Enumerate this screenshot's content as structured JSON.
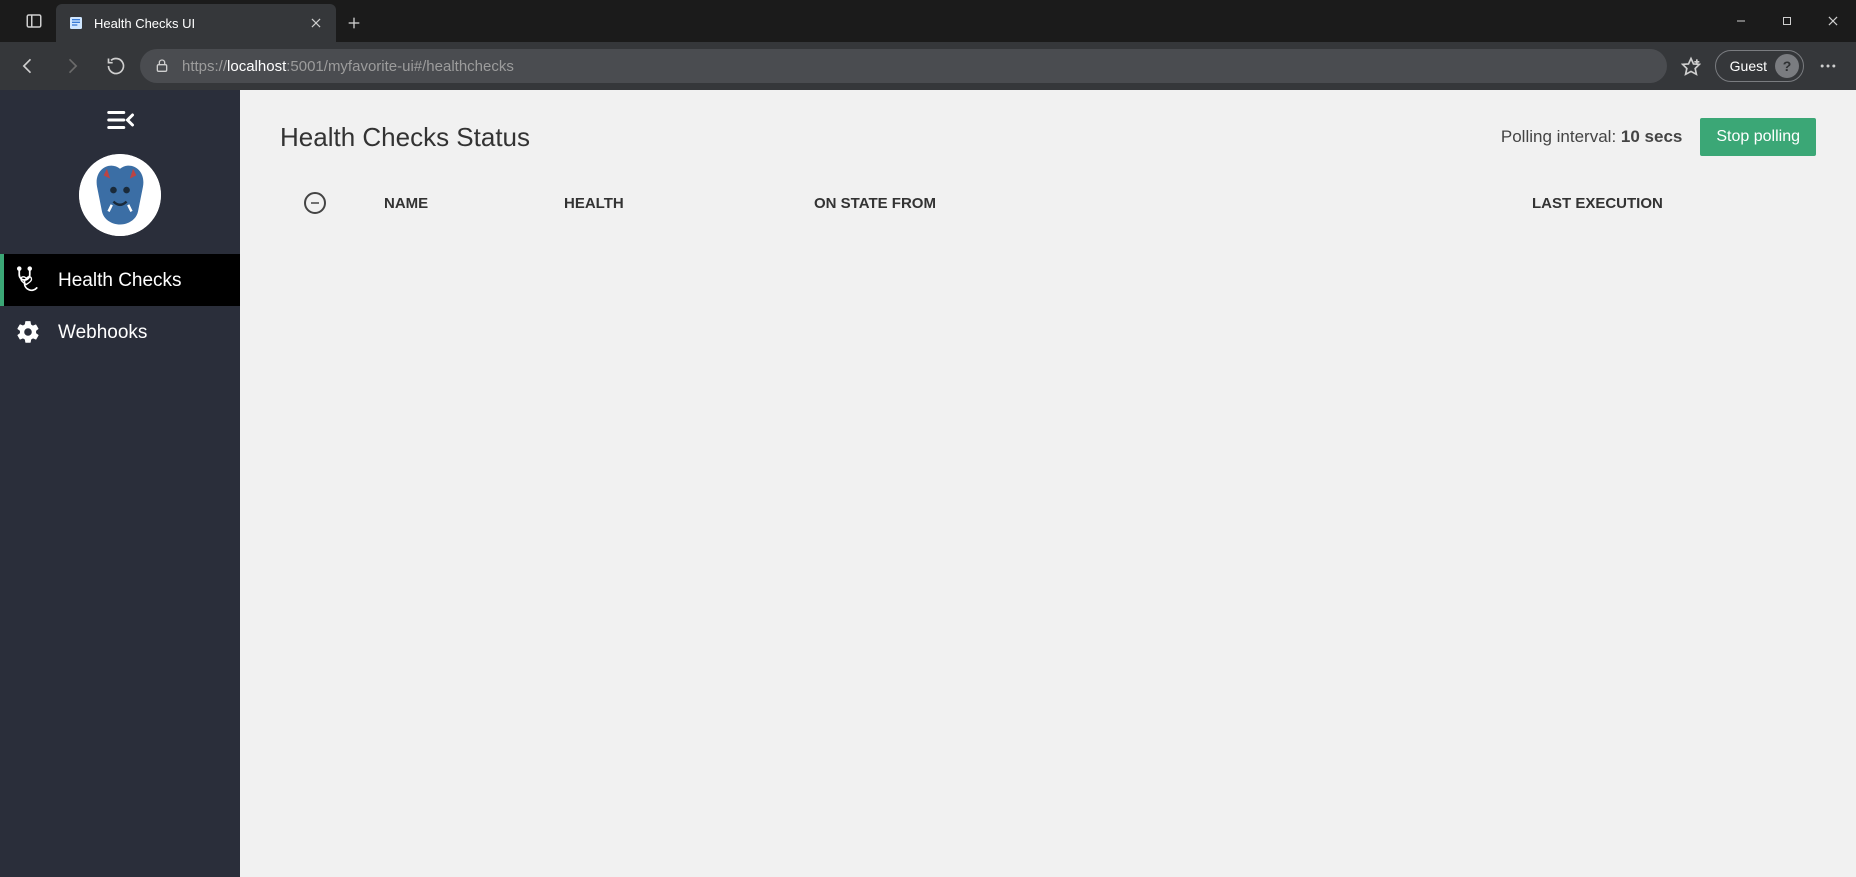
{
  "browser": {
    "tab_title": "Health Checks UI",
    "url_prefix": "https://",
    "url_host": "localhost",
    "url_rest": ":5001/myfavorite-ui#/healthchecks",
    "profile_label": "Guest"
  },
  "sidebar": {
    "items": [
      {
        "key": "healthchecks",
        "label": "Health Checks",
        "icon": "stethoscope-icon",
        "active": true
      },
      {
        "key": "webhooks",
        "label": "Webhooks",
        "icon": "gear-icon",
        "active": false
      }
    ]
  },
  "page": {
    "title": "Health Checks Status",
    "polling_prefix": "Polling interval: ",
    "polling_value": "10",
    "polling_suffix": " secs",
    "stop_label": "Stop polling"
  },
  "table": {
    "headers": {
      "name": "NAME",
      "health": "HEALTH",
      "on_state_from": "ON STATE FROM",
      "last_execution": "LAST EXECUTION"
    },
    "rows": []
  }
}
